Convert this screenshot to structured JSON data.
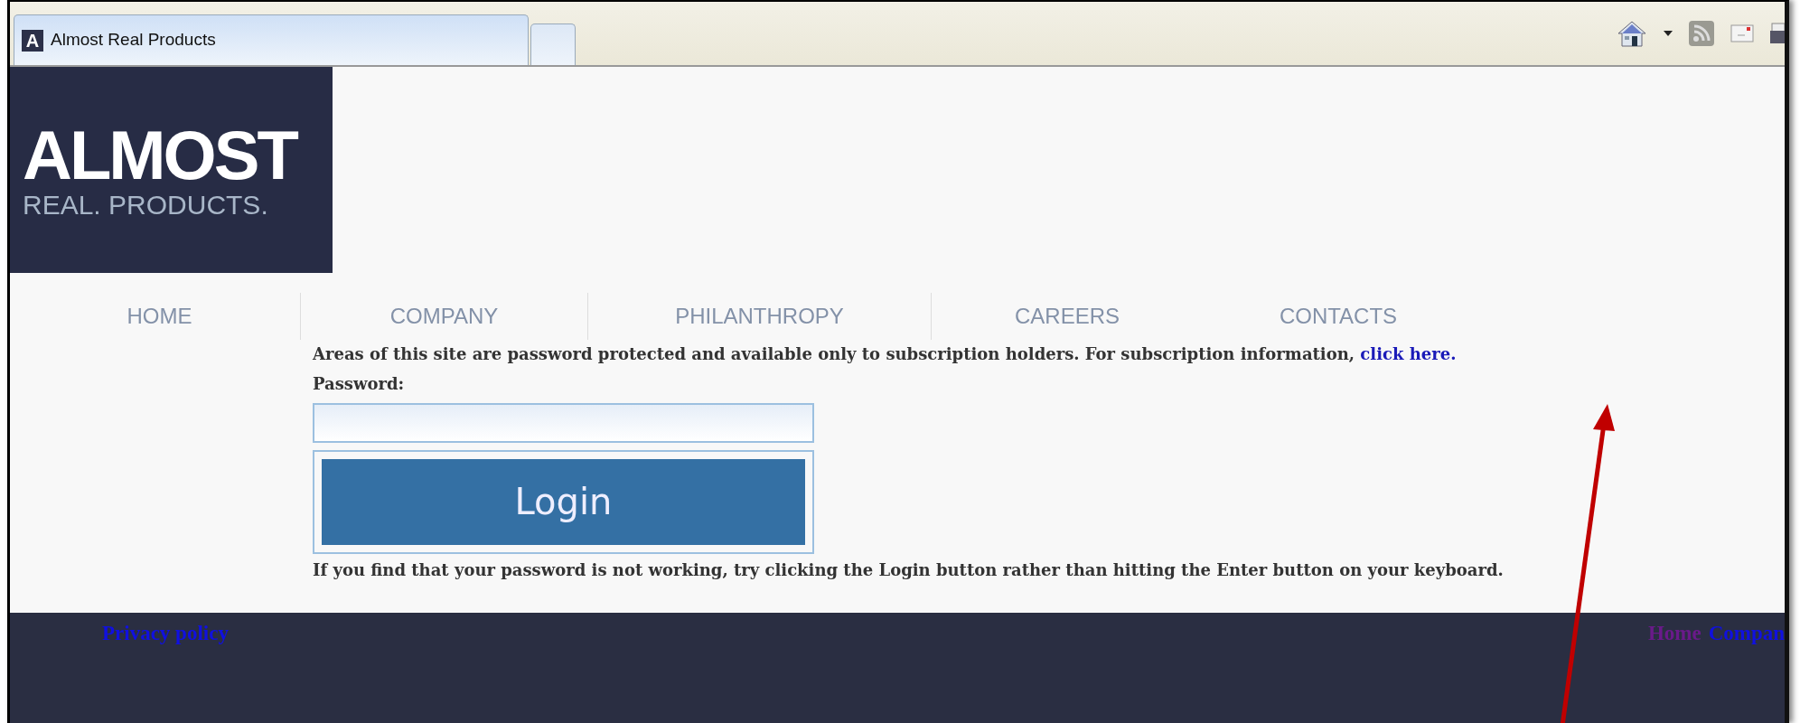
{
  "browser": {
    "tab_title": "Almost Real Products",
    "tab_icon_letter": "A",
    "selected_tab": true
  },
  "logo": {
    "line_1": "ALMOST",
    "line_2": "REAL. PRODUCTS."
  },
  "nav": [
    {
      "label": "HOME"
    },
    {
      "label": "COMPANY"
    },
    {
      "label": "PHILANTHROPY"
    },
    {
      "label": "CAREERS"
    },
    {
      "label": "CONTACTS"
    }
  ],
  "notice": {
    "text": "Areas of this site are password protected and available only to subscription holders. For subscription information,",
    "link": "click here."
  },
  "password": {
    "label": "Password:"
  },
  "login_button": "Login",
  "hint": "If you find that your password is not working, try clicking the Login button rather than hitting the Enter button on your keyboard.",
  "footer": {
    "left_links": [
      {
        "label": "Privacy policy",
        "visited": false
      }
    ],
    "right_links": [
      {
        "label": "Home",
        "visited": true
      },
      {
        "label": "Compan",
        "visited": false
      }
    ]
  }
}
